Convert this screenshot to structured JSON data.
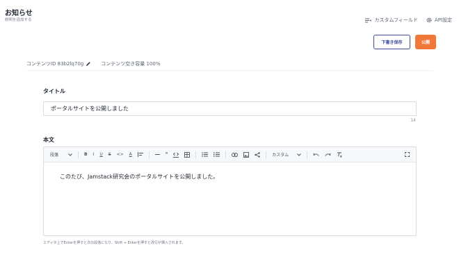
{
  "header": {
    "title": "お知らせ",
    "subtitle": "説明を追加する"
  },
  "top_links": {
    "custom_field": "カスタムフィールド",
    "api_settings": "API設定"
  },
  "actions": {
    "draft_label": "下書き保存",
    "publish_label": "公開"
  },
  "meta": {
    "content_id": "コンテンツID 83b2lq70g",
    "capacity": "コンテンツ空き容量 100%"
  },
  "fields": {
    "title_label": "タイトル",
    "title_value": "ポータルサイトを公開しました",
    "title_char_count": "14",
    "body_label": "本文",
    "body_value": "このたび、Jamstack研究会のポータルサイトを公開しました。"
  },
  "toolbar": {
    "paragraph": "段落",
    "bold": "B",
    "italic": "I",
    "underline": "U",
    "strike": "S",
    "code": "<>",
    "color": "A",
    "quote": "❞",
    "custom": "カスタム"
  },
  "helper_text": "エディタ上でEnterを押すと次の段落になり、Shift + Enterを押すと改行が挿入されます。",
  "colors": {
    "accent": "#3d4a9e",
    "publish": "#f2783a"
  }
}
